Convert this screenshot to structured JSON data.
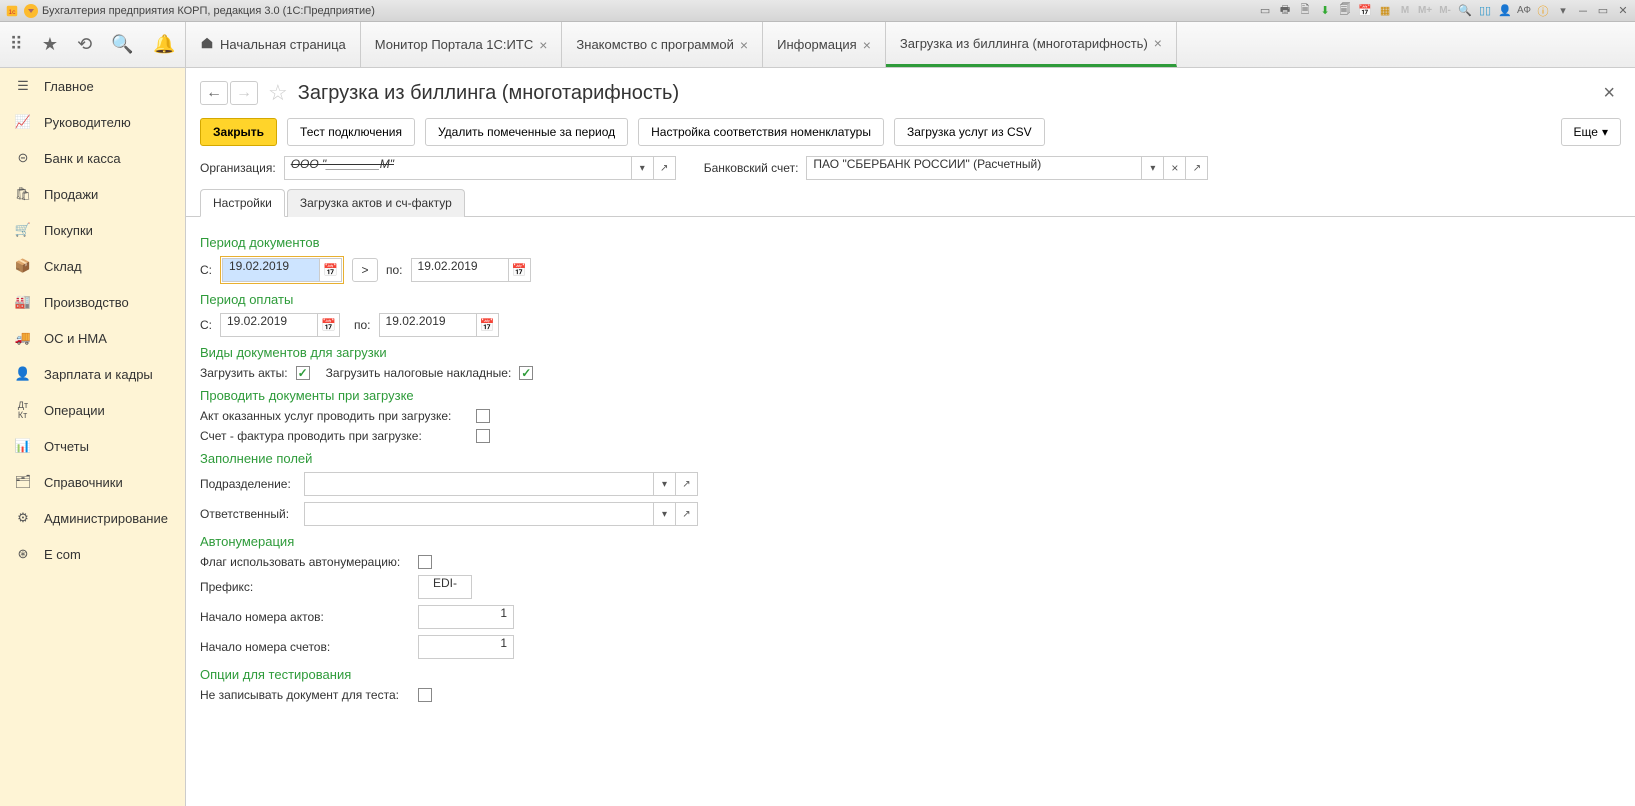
{
  "title_bar": {
    "app_title": "Бухгалтерия предприятия КОРП, редакция 3.0  (1С:Предприятие)",
    "user_label": "АФ"
  },
  "top_tabs": {
    "home": "Начальная страница",
    "t1": "Монитор Портала 1С:ИТС",
    "t2": "Знакомство с программой",
    "t3": "Информация",
    "t4": "Загрузка из биллинга (многотарифность)"
  },
  "sidebar": {
    "items": [
      "Главное",
      "Руководителю",
      "Банк и касса",
      "Продажи",
      "Покупки",
      "Склад",
      "Производство",
      "ОС и НМА",
      "Зарплата и кадры",
      "Операции",
      "Отчеты",
      "Справочники",
      "Администрирование",
      "E com"
    ]
  },
  "page": {
    "title": "Загрузка из биллинга (многотарифность)",
    "close_btn": "Закрыть",
    "test_btn": "Тест подключения",
    "delete_btn": "Удалить помеченные за период",
    "nom_btn": "Настройка соответствия номенклатуры",
    "load_csv_btn": "Загрузка услуг из CSV",
    "more_btn": "Еще"
  },
  "org_row": {
    "org_label": "Организация:",
    "org_value": "ООО \"________М\"",
    "bank_label": "Банковский счет:",
    "bank_value": "ПАО \"СБЕРБАНК РОССИИ\" (Расчетный)"
  },
  "form_tabs": {
    "t1": "Настройки",
    "t2": "Загрузка актов и сч-фактур"
  },
  "sections": {
    "period_docs": "Период документов",
    "period_pay": "Период оплаты",
    "doc_types": "Виды документов для загрузки",
    "conduct": "Проводить документы при загрузке",
    "fill_fields": "Заполнение полей",
    "autonum": "Автонумерация",
    "test_opts": "Опции для тестирования"
  },
  "labels": {
    "from": "С:",
    "to": "по:",
    "load_acts": "Загрузить акты:",
    "load_tax": "Загрузить налоговые накладные:",
    "act_conduct": "Акт оказанных услуг проводить при загрузке:",
    "invoice_conduct": "Счет - фактура проводить при загрузке:",
    "division": "Подразделение:",
    "responsible": "Ответственный:",
    "autonum_flag": "Флаг использовать автонумерацию:",
    "prefix": "Префикс:",
    "acts_start": "Начало номера актов:",
    "invoices_start": "Начало номера счетов:",
    "no_write_test": "Не записывать документ для теста:"
  },
  "values": {
    "docs_from": "19.02.2019",
    "docs_to": "19.02.2019",
    "pay_from": "19.02.2019",
    "pay_to": "19.02.2019",
    "prefix": "EDI-",
    "acts_start": "1",
    "invoices_start": "1",
    "division": "",
    "responsible": ""
  }
}
